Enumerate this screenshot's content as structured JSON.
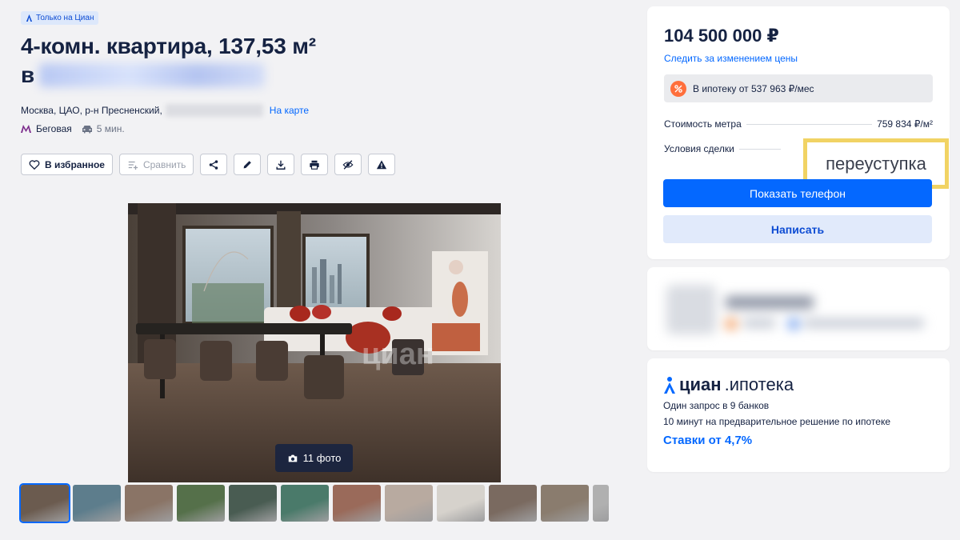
{
  "listing": {
    "badge": "Только на Циан",
    "title_line1": "4-комн. квартира, 137,53 м²",
    "title_line2_prefix": "в",
    "address": "Москва, ЦАО, р-н Пресненский,",
    "map_link": "На карте",
    "metro_station": "Беговая",
    "metro_time": "5 мин."
  },
  "actions": {
    "favorite_label": "В избранное",
    "compare_label": "Сравнить"
  },
  "gallery": {
    "photo_count_label": "11 фото",
    "watermark": "циан",
    "thumbnail_colors": [
      "#6b5b4f",
      "#5d7d8c",
      "#8a7466",
      "#55704a",
      "#495c52",
      "#4a7a6a",
      "#9a6a5a",
      "#b8aaa0",
      "#d6d2cc",
      "#7a6a60",
      "#8a7c6e",
      "#b0b0b0"
    ]
  },
  "sidebar": {
    "price": "104 500 000 ₽",
    "watch_price": "Следить за изменением цены",
    "mortgage_text": "В ипотеку от 537 963 ₽/мес",
    "price_per_meter_label": "Стоимость метра",
    "price_per_meter_value": "759 834 ₽/м²",
    "deal_terms_label": "Условия сделки",
    "deal_terms_value": "переуступка",
    "show_phone": "Показать телефон",
    "write": "Написать"
  },
  "ipoteka": {
    "brand": "циан",
    "product": ".ипотека",
    "line1": "Один запрос в 9 банков",
    "line2": "10 минут на предварительное решение по ипотеке",
    "rate_link": "Ставки от 4,7%"
  },
  "colors": {
    "accent": "#0468ff",
    "highlight_border": "#f1d364",
    "metro": "#7c2c8c",
    "mortgage_icon": "#ff6f3c"
  }
}
